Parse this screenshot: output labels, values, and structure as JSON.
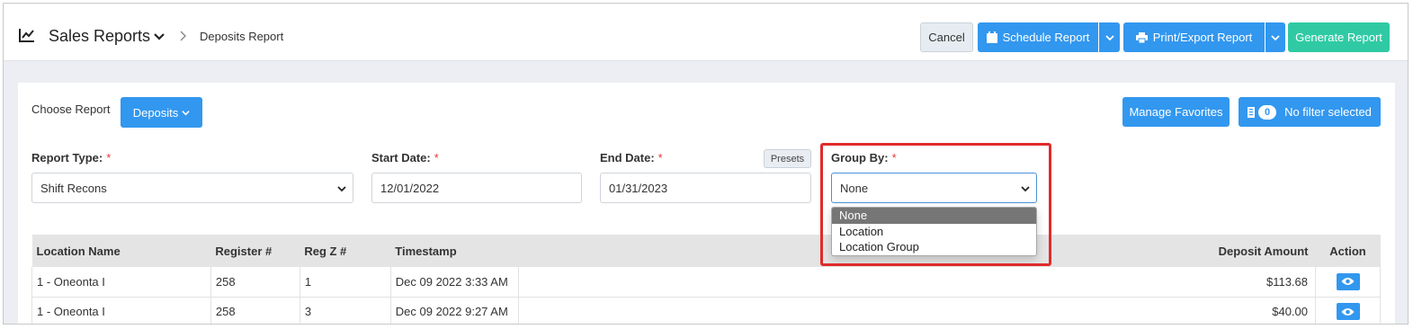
{
  "header": {
    "title": "Sales Reports",
    "breadcrumb": "Deposits Report",
    "cancel_label": "Cancel",
    "schedule_label": "Schedule Report",
    "print_label": "Print/Export Report",
    "generate_label": "Generate Report"
  },
  "toolbar": {
    "choose_label": "Choose Report",
    "report_button_label": "Deposits",
    "manage_favorites_label": "Manage Favorites",
    "filter_count": "0",
    "filter_label": "No filter selected"
  },
  "form": {
    "report_type": {
      "label": "Report Type:",
      "required": "*",
      "value": "Shift Recons"
    },
    "start_date": {
      "label": "Start Date:",
      "required": "*",
      "value": "12/01/2022"
    },
    "end_date": {
      "label": "End Date:",
      "required": "*",
      "value": "01/31/2023"
    },
    "presets_label": "Presets",
    "group_by": {
      "label": "Group By:",
      "required": "*",
      "value": "None",
      "options": [
        "None",
        "Location",
        "Location Group"
      ]
    }
  },
  "table": {
    "columns": [
      "Location Name",
      "Register #",
      "Reg Z #",
      "Timestamp",
      "Deposit Amount",
      "Action"
    ],
    "rows": [
      {
        "location": "1 - Oneonta I",
        "register": "258",
        "regz": "1",
        "timestamp": "Dec 09 2022 3:33 AM",
        "amount": "$113.68"
      },
      {
        "location": "1 - Oneonta I",
        "register": "258",
        "regz": "3",
        "timestamp": "Dec 09 2022 9:27 AM",
        "amount": "$40.00"
      }
    ]
  },
  "colors": {
    "primary": "#3297ef",
    "generate": "#2fcaa4",
    "highlight": "#e02b2b",
    "required": "#e03a3a"
  },
  "icons": [
    "chart-line-icon",
    "chevron-down-icon",
    "chevron-right-icon",
    "calendar-icon",
    "printer-icon",
    "list-icon",
    "eye-icon"
  ]
}
